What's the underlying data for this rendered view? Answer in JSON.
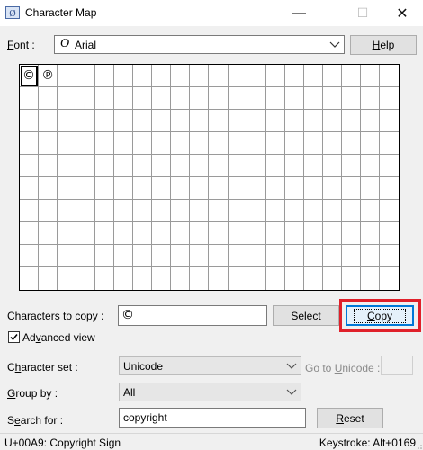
{
  "window": {
    "title": "Character Map",
    "minimize_glyph": "—",
    "maximize_glyph": "☐",
    "close_glyph": "✕"
  },
  "font": {
    "label_html_u": "F",
    "label_rest": "ont :",
    "value": "Arial",
    "font_icon": "O"
  },
  "help_button": {
    "u": "H",
    "rest": "elp"
  },
  "grid": {
    "characters": [
      "©",
      "℗"
    ],
    "selected_index": 0
  },
  "copy_area": {
    "label": "Characters to copy :",
    "value": "©",
    "select_label": "Select",
    "copy_u": "C",
    "copy_rest": "opy"
  },
  "advanced_view": {
    "label_pre": "Ad",
    "label_u": "v",
    "label_post": "anced view",
    "checked": true
  },
  "character_set": {
    "label_pre": "C",
    "label_u": "h",
    "label_post": "aracter set :",
    "value": "Unicode"
  },
  "goto_unicode": {
    "label_pre": "Go to ",
    "label_u": "U",
    "label_post": "nicode :",
    "value": ""
  },
  "group_by": {
    "label_u": "G",
    "label_post": "roup by :",
    "value": "All"
  },
  "search": {
    "label_pre": "S",
    "label_u": "e",
    "label_post": "arch for :",
    "value": "copyright",
    "reset_u": "R",
    "reset_rest": "eset"
  },
  "status": {
    "left": "U+00A9: Copyright Sign",
    "right": "Keystroke: Alt+0169"
  },
  "colors": {
    "highlight_red": "#e0202a",
    "copy_button_border": "#0078d7",
    "dialog_bg": "#f0f0f0"
  }
}
